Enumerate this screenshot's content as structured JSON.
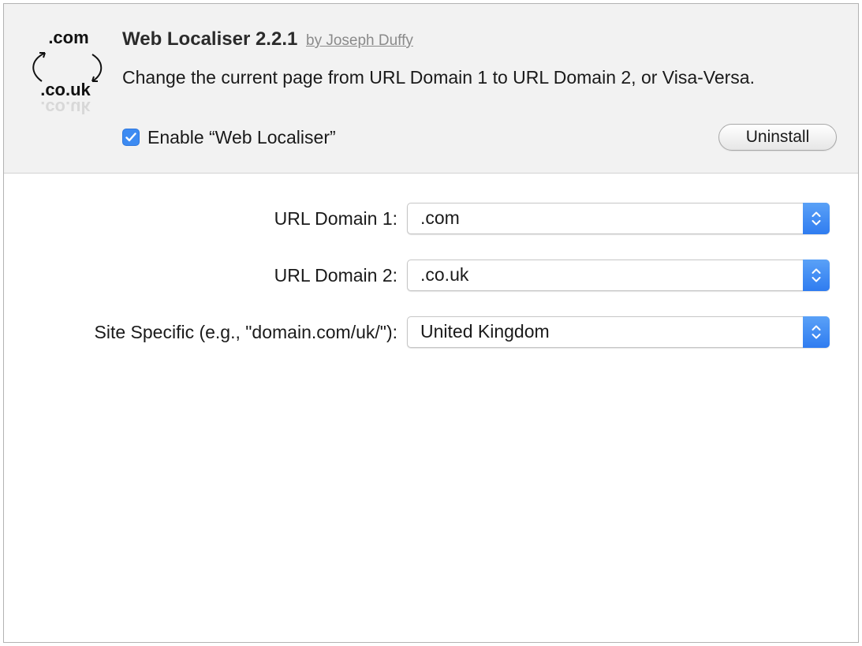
{
  "extension": {
    "icon_top_text": ".com",
    "icon_bottom_text": ".co.uk",
    "icon_reflection_text": ".co.uk",
    "name": "Web Localiser 2.2.1",
    "author": "by Joseph Duffy",
    "description": "Change the current page from URL Domain 1 to URL Domain 2, or Visa-Versa.",
    "enable_label": "Enable “Web Localiser”",
    "enabled": true,
    "uninstall_label": "Uninstall"
  },
  "settings": [
    {
      "label": "URL Domain 1:",
      "value": ".com"
    },
    {
      "label": "URL Domain 2:",
      "value": ".co.uk"
    },
    {
      "label": "Site Specific (e.g., \"domain.com/uk/\"):",
      "value": "United Kingdom"
    }
  ],
  "colors": {
    "accent": "#3d8bf2",
    "header_bg": "#f2f2f2",
    "author_gray": "#8a8a8a"
  }
}
